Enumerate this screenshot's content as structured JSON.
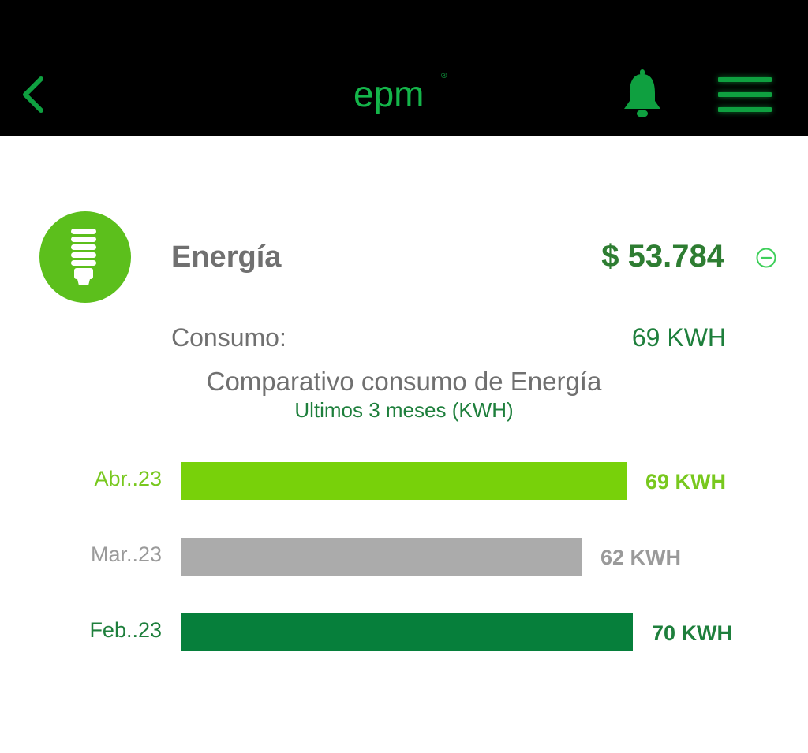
{
  "header": {
    "logo_text": "epm",
    "logo_mark": "®",
    "back_icon": "chevron-left-icon",
    "notifications_icon": "bell-icon",
    "menu_icon": "hamburger-menu-icon",
    "accent_color": "#0fa040"
  },
  "service": {
    "icon": "lightbulb-icon",
    "title": "Energía",
    "amount": "$ 53.784",
    "collapse_icon": "minus-circle-icon",
    "consumo_label": "Consumo:",
    "consumo_value": "69 KWH"
  },
  "comparison": {
    "title": "Comparativo consumo de Energía",
    "subtitle": "Ultimos 3 meses (KWH)"
  },
  "chart_data": {
    "type": "bar",
    "orientation": "horizontal",
    "categories": [
      "Abr..23",
      "Mar..23",
      "Feb..23"
    ],
    "values": [
      69,
      62,
      70
    ],
    "value_labels": [
      "69 KWH",
      "62 KWH",
      "70 KWH"
    ],
    "colors": [
      "#78d10a",
      "#ababab",
      "#067f3b"
    ],
    "label_colors": [
      "#78c81e",
      "#9a9a9a",
      "#1e7f3c"
    ],
    "title": "Comparativo consumo de Energía",
    "subtitle": "Ultimos 3 meses (KWH)",
    "xlim": [
      0,
      70
    ],
    "grid": false
  }
}
